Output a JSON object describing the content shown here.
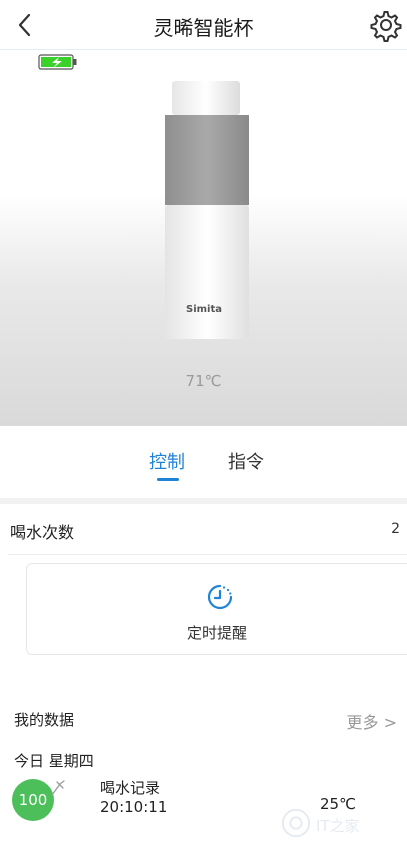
{
  "header": {
    "title": "灵晞智能杯",
    "back_icon": "chevron-left-icon",
    "settings_icon": "gear-icon"
  },
  "device": {
    "brand": "Simita",
    "temperature": "71℃",
    "battery_icon": "battery-charging-icon"
  },
  "tabs": [
    {
      "label": "控制",
      "active": true
    },
    {
      "label": "指令",
      "active": false
    }
  ],
  "drink_count": {
    "label": "喝水次数",
    "value": "2"
  },
  "timer": {
    "label": "定时提醒",
    "icon": "clock-icon"
  },
  "my_data": {
    "title": "我的数据",
    "more": "更多 >",
    "date": "今日 星期四",
    "record": {
      "badge": "100",
      "label": "喝水记录",
      "time": "20:10:11",
      "temp": "25℃"
    }
  },
  "watermark": {
    "text": "IT之家"
  },
  "colors": {
    "accent": "#1f83d6",
    "badge": "#4cbf5a",
    "battery": "#39d12a"
  }
}
